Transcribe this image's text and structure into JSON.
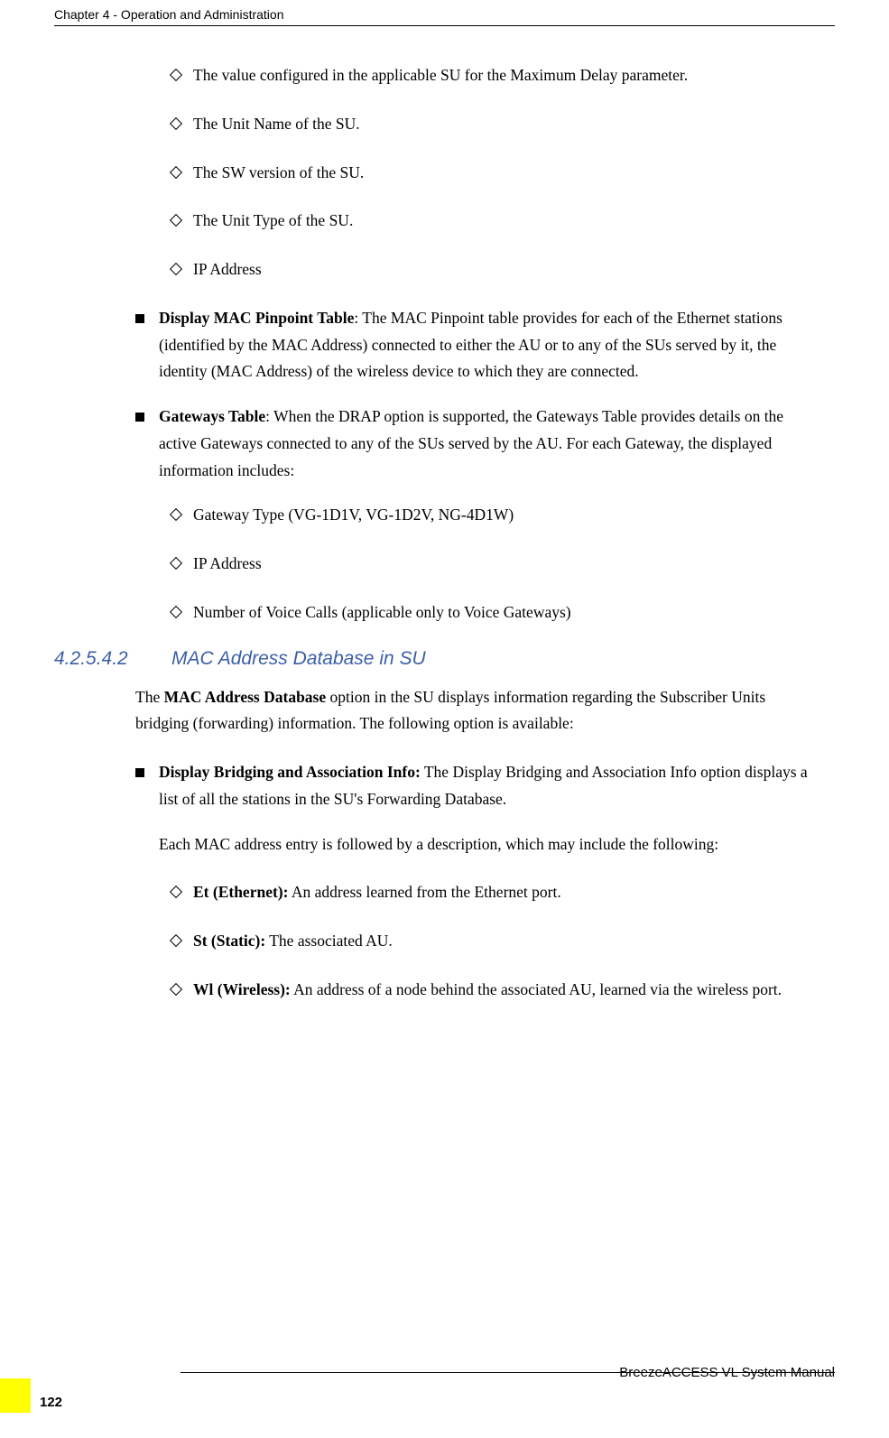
{
  "header": {
    "chapter": "Chapter 4 - Operation and Administration"
  },
  "items": {
    "diamond1": "The value configured in the applicable SU for the Maximum Delay parameter.",
    "diamond2": "The Unit Name of the SU.",
    "diamond3": "The SW version of the SU.",
    "diamond4": "The Unit Type of the SU.",
    "diamond5": "IP Address",
    "square1_bold": "Display MAC Pinpoint Table",
    "square1_text": ": The MAC Pinpoint table provides for each of the Ethernet stations (identified by the MAC Address) connected to either the AU or to any of the SUs served by it, the identity (MAC Address) of the wireless device to which they are connected.",
    "square2_bold": "Gateways Table",
    "square2_text": ": When the DRAP option is supported, the Gateways Table provides details on the active Gateways connected to any of the SUs served by the AU. For each Gateway, the displayed information includes:",
    "diamond6": "Gateway Type (VG-1D1V, VG-1D2V, NG-4D1W)",
    "diamond7": "IP Address",
    "diamond8": "Number of Voice Calls (applicable only to Voice Gateways)"
  },
  "section": {
    "number": "4.2.5.4.2",
    "title": "MAC Address Database in SU"
  },
  "paragraph": {
    "p1_pre": "The ",
    "p1_bold": "MAC Address Database",
    "p1_post": " option in the SU displays information regarding the Subscriber Units bridging (forwarding) information. The following option is available:"
  },
  "items2": {
    "square3_bold": "Display Bridging and Association Info:",
    "square3_text": " The Display Bridging and Association Info option displays a list of all the stations in the SU's Forwarding Database.",
    "sub_para": "Each MAC address entry is followed by a description, which may include the following:",
    "diamond9_bold": "Et (Ethernet):",
    "diamond9_text": " An address learned from the Ethernet port.",
    "diamond10_bold": "St (Static):",
    "diamond10_text": " The associated AU.",
    "diamond11_bold": "Wl (Wireless):",
    "diamond11_text": " An address of a node behind the associated AU, learned via the wireless port."
  },
  "footer": {
    "page": "122",
    "manual": "BreezeACCESS VL System Manual"
  }
}
